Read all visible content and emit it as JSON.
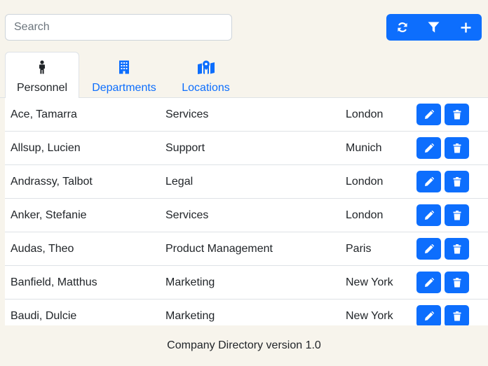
{
  "search": {
    "placeholder": "Search",
    "value": ""
  },
  "toolbar": {
    "icons": [
      "refresh-icon",
      "filter-icon",
      "plus-icon"
    ]
  },
  "tabs": [
    {
      "label": "Personnel",
      "icon": "person-icon",
      "active": true
    },
    {
      "label": "Departments",
      "icon": "building-icon",
      "active": false
    },
    {
      "label": "Locations",
      "icon": "map-location-icon",
      "active": false
    }
  ],
  "personnel": [
    {
      "name": "Ace, Tamarra",
      "department": "Services",
      "location": "London"
    },
    {
      "name": "Allsup, Lucien",
      "department": "Support",
      "location": "Munich"
    },
    {
      "name": "Andrassy, Talbot",
      "department": "Legal",
      "location": "London"
    },
    {
      "name": "Anker, Stefanie",
      "department": "Services",
      "location": "London"
    },
    {
      "name": "Audas, Theo",
      "department": "Product Management",
      "location": "Paris"
    },
    {
      "name": "Banfield, Matthus",
      "department": "Marketing",
      "location": "New York"
    },
    {
      "name": "Baudi, Dulcie",
      "department": "Marketing",
      "location": "New York"
    }
  ],
  "row_actions": {
    "edit_icon": "pencil-icon",
    "delete_icon": "trash-icon"
  },
  "footer": {
    "text": "Company Directory version 1.0"
  },
  "colors": {
    "primary": "#0d6efd",
    "background": "#f7f4ec",
    "border": "#dee2e6"
  }
}
